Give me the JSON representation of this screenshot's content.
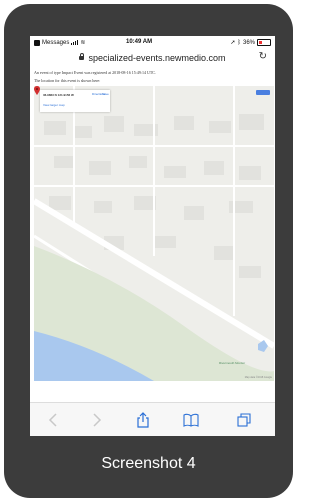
{
  "statusbar": {
    "app": "Messages",
    "time": "10:49 AM",
    "battery": "36%"
  },
  "browser": {
    "url": "specialized-events.newmedio.com"
  },
  "page": {
    "message_line1": "An event of type Impact Event was registered at 2018-08-16 15:49:14 UTC.",
    "message_line2": "The location for this event is shown here:"
  },
  "map": {
    "info_coords": "36.9863 N 121.9156 W",
    "info_directions": "Directions",
    "info_save": "Save",
    "info_larger": "View larger map",
    "poi_label": "Rivermouth Monitor",
    "zoom_in": "+",
    "zoom_out": "−",
    "footer": "Map data ©2018 Google"
  },
  "caption": "Screenshot 4",
  "colors": {
    "card_bg": "#3c3c3c",
    "accent_blue": "#2a6fd6",
    "pin_red": "#d32f2f"
  }
}
